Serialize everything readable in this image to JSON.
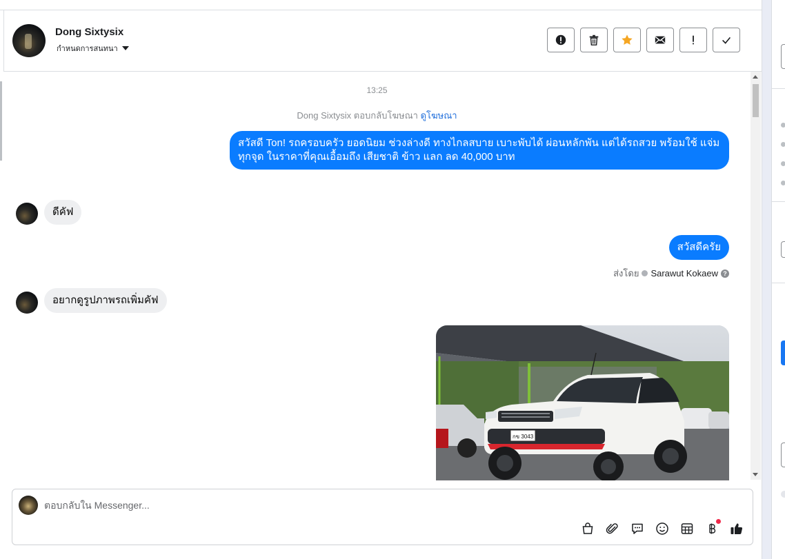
{
  "header": {
    "contact_name": "Dong Sixtysix",
    "subtitle": "กำหนดการสนทนา",
    "actions": [
      "mark-spam",
      "delete",
      "star",
      "mark-unread",
      "follow-up",
      "mark-done"
    ]
  },
  "messages": {
    "timestamp": "13:25",
    "reply_note_prefix": "Dong Sixtysix ตอบกลับโฆษณา",
    "reply_note_link": "ดูโฆษณา",
    "m1_out": "สวัสดี Ton! รถครอบครัว ยอดนิยม ช่วงล่างดี ทางไกลสบาย เบาะพับได้ ผ่อนหลักพัน แต่ได้รถสวย พร้อมใช้ แจ่มทุกจุด ในราคาที่คุณเอื้อมถึง เสียชาติ ข้าว แลก ลด 40,000 บาท",
    "m2_in": "ดีคัฟ",
    "m3_out": "สวัสดีครัย",
    "sent_by_label": "ส่งโดย",
    "sent_by_name": "Sarawut Kokaew",
    "m4_in": "อยากดูรูปภาพรถเพิ่มคัฟ",
    "photo_plate": "กข 3043"
  },
  "composer": {
    "placeholder": "ตอบกลับใน Messenger..."
  },
  "colors": {
    "outgoing_bubble": "#0a7cff",
    "incoming_bubble": "#eeeff1",
    "star": "#f5a623",
    "notification_dot": "#f02849"
  }
}
